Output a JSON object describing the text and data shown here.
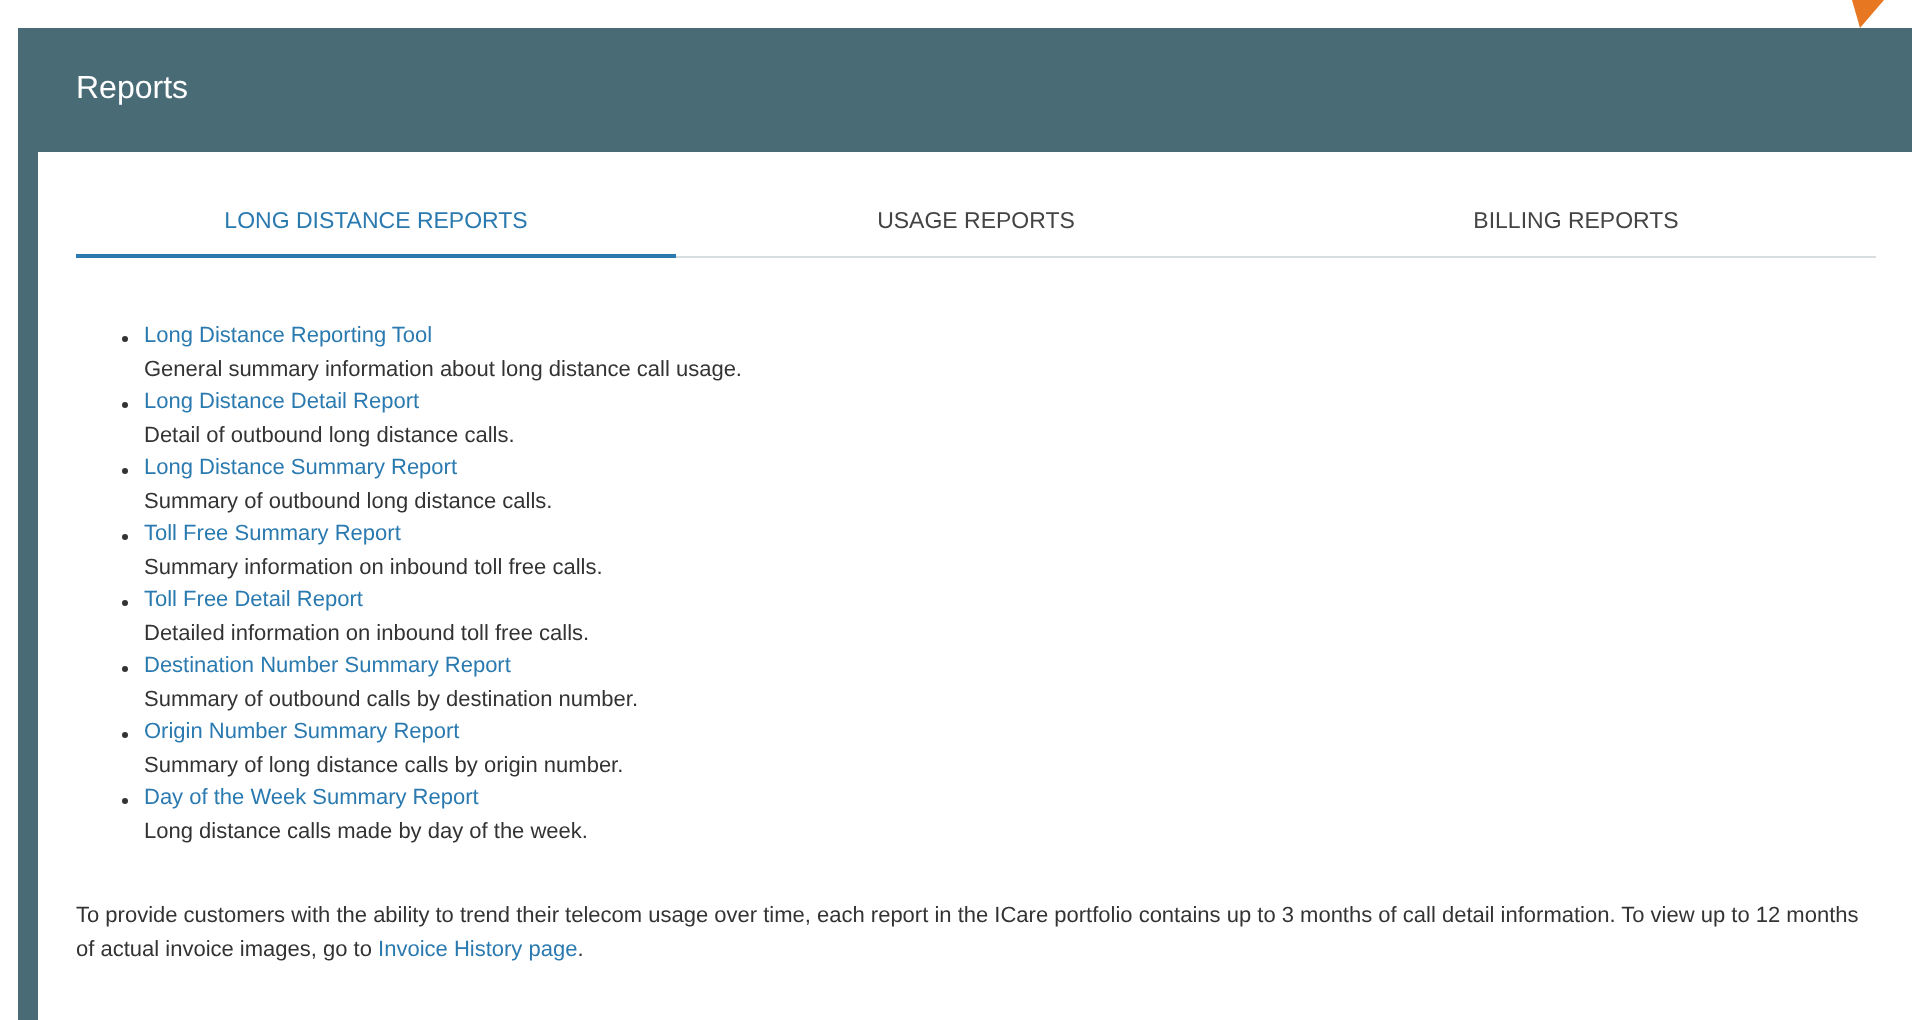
{
  "page": {
    "title": "Reports"
  },
  "tabs": [
    {
      "label": "LONG DISTANCE REPORTS",
      "selected": true
    },
    {
      "label": "USAGE REPORTS",
      "selected": false
    },
    {
      "label": "BILLING REPORTS",
      "selected": false
    }
  ],
  "reports": [
    {
      "link": "Long Distance Reporting Tool",
      "description": "General summary information about long distance call usage."
    },
    {
      "link": "Long Distance Detail Report",
      "description": "Detail of outbound long distance calls."
    },
    {
      "link": "Long Distance Summary Report",
      "description": "Summary of outbound long distance calls."
    },
    {
      "link": "Toll Free Summary Report",
      "description": "Summary information on inbound toll free calls."
    },
    {
      "link": "Toll Free Detail Report",
      "description": "Detailed information on inbound toll free calls."
    },
    {
      "link": "Destination Number Summary Report",
      "description": "Summary of outbound calls by destination number."
    },
    {
      "link": "Origin Number Summary Report",
      "description": "Summary of long distance calls by origin number."
    },
    {
      "link": "Day of the Week Summary Report",
      "description": "Long distance calls made by day of the week."
    }
  ],
  "note": {
    "text": "To provide customers with the ability to trend their telecom usage over time, each report in the ICare portfolio contains up to 3 months of call detail information. To view up to 12 months of actual invoice images, go to",
    "link": "Invoice History page",
    "after": "."
  }
}
